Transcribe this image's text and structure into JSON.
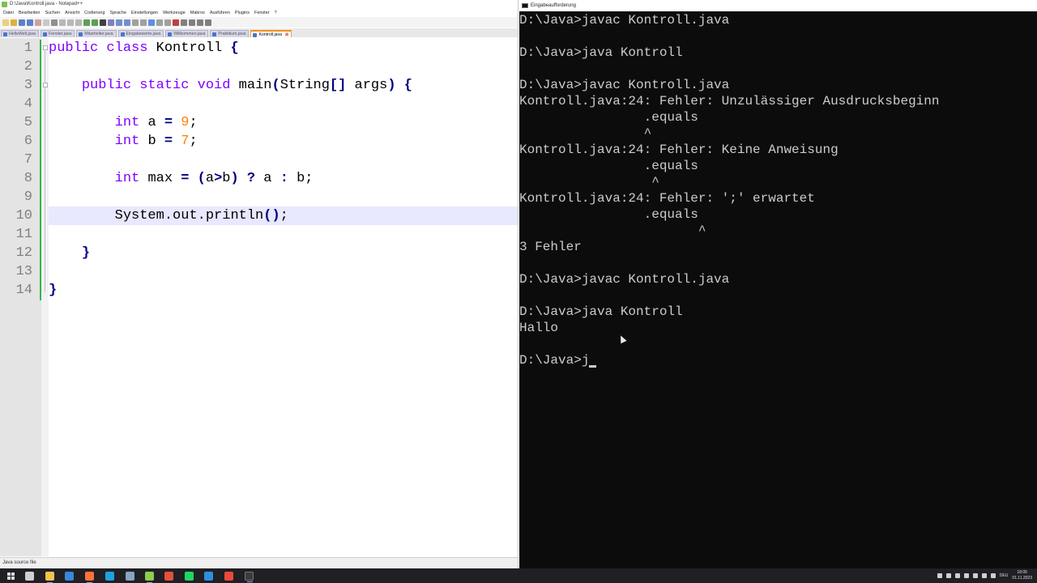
{
  "editor": {
    "window_title": "D:\\Java\\Kontroll.java - Notepad++",
    "menu": [
      "Datei",
      "Bearbeiten",
      "Suchen",
      "Ansicht",
      "Codierung",
      "Sprache",
      "Einstellungen",
      "Werkzeuge",
      "Makros",
      "Ausführen",
      "Plugins",
      "Fenster",
      "?"
    ],
    "tabs": [
      {
        "label": "HelloWelt.java",
        "active": false
      },
      {
        "label": "Fenster.java",
        "active": false
      },
      {
        "label": "Mitarbeiter.java",
        "active": false
      },
      {
        "label": "Eingabewerte.java",
        "active": false
      },
      {
        "label": "Willkommen.java",
        "active": false
      },
      {
        "label": "Praktikum.java",
        "active": false
      },
      {
        "label": "Kontroll.java",
        "active": true
      }
    ],
    "tab_close_glyph": "⊠",
    "line_numbers": [
      "1",
      "2",
      "3",
      "4",
      "5",
      "6",
      "7",
      "8",
      "9",
      "10",
      "11",
      "12",
      "13",
      "14"
    ],
    "code": {
      "l1_kw1": "public",
      "l1_kw2": "class",
      "l1_name": "Kontroll",
      "l1_brace": "{",
      "l3_kw1": "public",
      "l3_kw2": "static",
      "l3_kw3": "void",
      "l3_name": "main",
      "l3_paren": "(",
      "l3_type": "String",
      "l3_arr": "[]",
      "l3_arg": "args",
      "l3_close": ")",
      "l3_brace": "{",
      "l5_type": "int",
      "l5_var": "a",
      "l5_eq": "=",
      "l5_val": "9",
      "l5_semi": ";",
      "l6_type": "int",
      "l6_var": "b",
      "l6_eq": "=",
      "l6_val": "7",
      "l6_semi": ";",
      "l8_type": "int",
      "l8_var": "max",
      "l8_eq": "=",
      "l8_p1": "(",
      "l8_a": "a",
      "l8_gt": ">",
      "l8_b": "b",
      "l8_p2": ")",
      "l8_q": "?",
      "l8_ra": "a",
      "l8_colon": ":",
      "l8_rb": "b",
      "l8_semi": ";",
      "l10_call": "System.out.println",
      "l10_parens": "()",
      "l10_semi": ";",
      "l12_brace": "}",
      "l14_brace": "}"
    },
    "status_text": "Java source file"
  },
  "console": {
    "window_title": "Eingabeaufforderung",
    "lines": [
      "D:\\Java>javac Kontroll.java",
      "",
      "D:\\Java>java Kontroll",
      "",
      "D:\\Java>javac Kontroll.java",
      "Kontroll.java:24: Fehler: Unzulässiger Ausdrucksbeginn",
      "                .equals",
      "                ^",
      "Kontroll.java:24: Fehler: Keine Anweisung",
      "                .equals",
      "                 ^",
      "Kontroll.java:24: Fehler: ';' erwartet",
      "                .equals",
      "                       ^",
      "3 Fehler",
      "",
      "D:\\Java>javac Kontroll.java",
      "",
      "D:\\Java>java Kontroll",
      "Hallo",
      "",
      "D:\\Java>j"
    ]
  },
  "taskbar": {
    "apps": [
      {
        "name": "search-icon",
        "color": "#d0d0d0"
      },
      {
        "name": "file-explorer-icon",
        "color": "#f2c14e"
      },
      {
        "name": "mail-icon",
        "color": "#3a86d8"
      },
      {
        "name": "firefox-icon",
        "color": "#ff7139"
      },
      {
        "name": "edge-icon",
        "color": "#1fa0e0"
      },
      {
        "name": "steam-icon",
        "color": "#8aa4c0"
      },
      {
        "name": "notepad-plus-plus-icon",
        "color": "#8ccf4d"
      },
      {
        "name": "editor-icon",
        "color": "#e2513d"
      },
      {
        "name": "spotify-icon",
        "color": "#1ed760"
      },
      {
        "name": "vscode-icon",
        "color": "#2d8fe0"
      },
      {
        "name": "chrome-icon",
        "color": "#e84a3c"
      },
      {
        "name": "terminal-icon",
        "color": "#555555"
      }
    ],
    "lang": "DEU",
    "time": "18:05",
    "date": "01.11.2023"
  },
  "colors": {
    "keyword": "#8000ff",
    "number": "#ff8000",
    "operator": "#000080",
    "console_bg": "#0c0c0c",
    "console_fg": "#cccccc",
    "current_line": "#e8e8ff"
  }
}
